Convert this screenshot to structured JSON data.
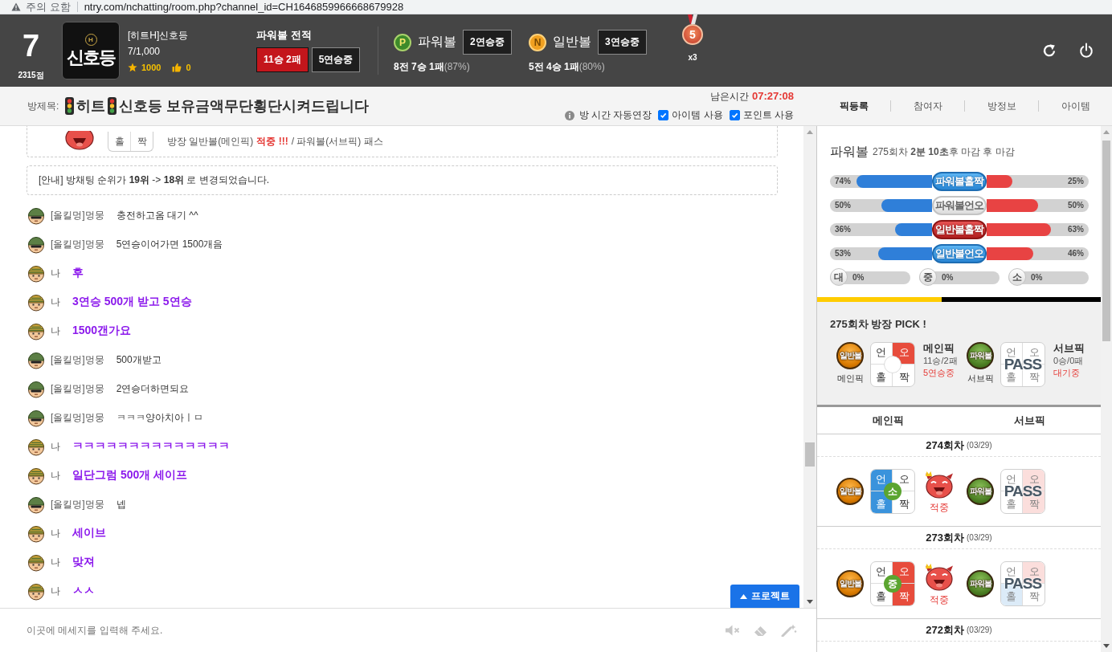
{
  "browser_bar": {
    "warning": "주의 요함",
    "url": "ntry.com/nchatting/room.php?channel_id=CH1646859966668679928"
  },
  "header": {
    "level": "7",
    "points": "2315점",
    "logo": {
      "emblem": "H",
      "text": "신호등"
    },
    "nickname": "[히트H]신호등",
    "members": "7/1,000",
    "stars": "1000",
    "likes": "0",
    "record": {
      "title": "파워볼 전적",
      "result": "11승 2패",
      "streak": "5연승중"
    },
    "games": [
      {
        "kind": "power",
        "badge": "P",
        "name": "파워볼",
        "streak": "2연승중",
        "record": "8전 7승 1패",
        "rate": "(87%)"
      },
      {
        "kind": "normal",
        "badge": "N",
        "name": "일반볼",
        "streak": "3연승중",
        "record": "5전 4승 1패",
        "rate": "(80%)"
      }
    ],
    "medal": {
      "number": "5",
      "multiplier": "x3"
    }
  },
  "title_bar": {
    "label": "방제목:",
    "segments": [
      {
        "kind": "icon"
      },
      {
        "kind": "text",
        "text": "히트"
      },
      {
        "kind": "icon"
      },
      {
        "kind": "text",
        "text": "신호등 보유금액무단횡단시켜드립니다"
      }
    ],
    "remaining_label": "남은시간",
    "remaining_time": "07:27:08",
    "auto_extend": "방 시간 자동연장",
    "options": [
      {
        "label": "아이템 사용",
        "checked": true
      },
      {
        "label": "포인트 사용",
        "checked": true
      }
    ]
  },
  "panel_tabs": [
    {
      "label": "픽등록",
      "selected": true
    },
    {
      "label": "참여자",
      "selected": false
    },
    {
      "label": "방정보",
      "selected": false
    },
    {
      "label": "아이템",
      "selected": false
    }
  ],
  "chat": {
    "notice_card": {
      "pick_cells": [
        "홀",
        "짝"
      ],
      "segments": [
        {
          "kind": "plain",
          "text": "방장 일반볼(메인픽)"
        },
        {
          "kind": "hit",
          "text": "적중 !!!"
        },
        {
          "kind": "plain",
          "text": "/ 파워볼(서브픽) 패스"
        }
      ]
    },
    "announcement": "[안내] 방채팅 순위가 **19위** -> **18위** 로 변경되었습니다.",
    "messages": [
      {
        "kind": "other",
        "sender": "[올킬멍]멍뭉",
        "text": "충전하고옴 대기 ^^"
      },
      {
        "kind": "other",
        "sender": "[올킬멍]멍뭉",
        "text": "5연승이어가면 1500개음"
      },
      {
        "kind": "me",
        "sender": "나",
        "text": "후"
      },
      {
        "kind": "me",
        "sender": "나",
        "text": "3연승 500개 받고 5연승"
      },
      {
        "kind": "me",
        "sender": "나",
        "text": "1500갠가요"
      },
      {
        "kind": "other",
        "sender": "[올킬멍]멍뭉",
        "text": "500개받고"
      },
      {
        "kind": "other",
        "sender": "[올킬멍]멍뭉",
        "text": "2연승더하면되요"
      },
      {
        "kind": "other",
        "sender": "[올킬멍]멍뭉",
        "text": "ㅋㅋㅋ양아치아ㅣㅁ"
      },
      {
        "kind": "me",
        "sender": "나",
        "text": "ㅋㅋㅋㅋㅋㅋㅋㅋㅋㅋㅋㅋㅋㅋ"
      },
      {
        "kind": "me",
        "sender": "나",
        "text": "일단그럼 500개 세이프"
      },
      {
        "kind": "other",
        "sender": "[올킬멍]멍뭉",
        "text": "넵"
      },
      {
        "kind": "me",
        "sender": "나",
        "text": "세이브"
      },
      {
        "kind": "me",
        "sender": "나",
        "text": "맞져"
      },
      {
        "kind": "me",
        "sender": "나",
        "text": "ㅅㅅ"
      }
    ],
    "protect_button": "프로젝트",
    "input": {
      "placeholder": "이곳에 메세지를 입력해 주세요."
    }
  },
  "stats": {
    "title": "파워볼",
    "subtitle": "275회차 **2분 10초**후 마감 후 마감",
    "bars": [
      {
        "label": "파워볼홀짝",
        "left": {
          "reading": "74%",
          "level": 0.74
        },
        "right": {
          "reading": "25%",
          "level": 0.25
        }
      },
      {
        "label": "파워볼언오",
        "left": {
          "reading": "50%",
          "level": 0.5
        },
        "right": {
          "reading": "50%",
          "level": 0.5
        }
      },
      {
        "label": "일반볼홀짝",
        "left": {
          "reading": "36%",
          "level": 0.36
        },
        "right": {
          "reading": "63%",
          "level": 0.63
        }
      },
      {
        "label": "일반볼언오",
        "left": {
          "reading": "53%",
          "level": 0.53
        },
        "right": {
          "reading": "46%",
          "level": 0.46
        }
      }
    ],
    "sizes": [
      {
        "label": "대",
        "reading": "0%",
        "level": 0
      },
      {
        "label": "중",
        "reading": "0%",
        "level": 0
      },
      {
        "label": "소",
        "reading": "0%",
        "level": 0
      }
    ],
    "countdown": {
      "level": 0.44
    }
  },
  "host_pick": {
    "title": "275회차 방장 PICK !",
    "picks": [
      {
        "ball": {
          "kind": "normal",
          "text": "일반볼"
        },
        "caption": "메인픽",
        "box": {
          "kind": "grid",
          "cells": [
            {
              "label": "언",
              "selected": false
            },
            {
              "label": "오",
              "selected": true
            },
            {
              "label": "홀",
              "selected": false
            },
            {
              "label": "짝",
              "selected": false
            }
          ]
        },
        "name": "메인픽",
        "record": "11승/2패",
        "status": "5연승중"
      },
      {
        "ball": {
          "kind": "power",
          "text": "파워볼"
        },
        "caption": "서브픽",
        "box": {
          "kind": "pass",
          "label": "PASS",
          "cells": [
            {
              "label": "언",
              "selected": false
            },
            {
              "label": "오",
              "selected": false
            },
            {
              "label": "홀",
              "selected": false
            },
            {
              "label": "짝",
              "selected": false
            }
          ]
        },
        "name": "서브픽",
        "record": "0승/0패",
        "status": "대기중"
      }
    ]
  },
  "history": {
    "columns": [
      "메인픽",
      "서브픽"
    ],
    "rounds": [
      {
        "round": "274회차",
        "date": "(03/29)",
        "main": {
          "ball": {
            "kind": "normal",
            "text": "일반볼"
          },
          "box": {
            "kind": "grid",
            "center": "소",
            "cells": [
              {
                "label": "언",
                "selected": true
              },
              {
                "label": "오",
                "selected": false
              },
              {
                "label": "홀",
                "selected": true
              },
              {
                "label": "짝",
                "selected": false
              }
            ]
          },
          "result": "적중"
        },
        "sub": {
          "ball": {
            "kind": "power",
            "text": "파워볼"
          },
          "box": {
            "kind": "pass",
            "label": "PASS",
            "cells": [
              {
                "label": "언",
                "selected": false
              },
              {
                "label": "오",
                "selected": true
              },
              {
                "label": "홀",
                "selected": false
              },
              {
                "label": "짝",
                "selected": true
              }
            ]
          }
        }
      },
      {
        "round": "273회차",
        "date": "(03/29)",
        "main": {
          "ball": {
            "kind": "normal",
            "text": "일반볼"
          },
          "box": {
            "kind": "grid",
            "center": "중",
            "cells": [
              {
                "label": "언",
                "selected": false
              },
              {
                "label": "오",
                "selected": true
              },
              {
                "label": "홀",
                "selected": false
              },
              {
                "label": "짝",
                "selected": true
              }
            ]
          },
          "result": "적중"
        },
        "sub": {
          "ball": {
            "kind": "power",
            "text": "파워볼"
          },
          "box": {
            "kind": "pass",
            "label": "PASS",
            "cells": [
              {
                "label": "언",
                "selected": false
              },
              {
                "label": "오",
                "selected": true
              },
              {
                "label": "홀",
                "selected": true
              },
              {
                "label": "짝",
                "selected": false
              }
            ]
          }
        }
      },
      {
        "round": "272회차",
        "date": "(03/29)"
      }
    ]
  }
}
